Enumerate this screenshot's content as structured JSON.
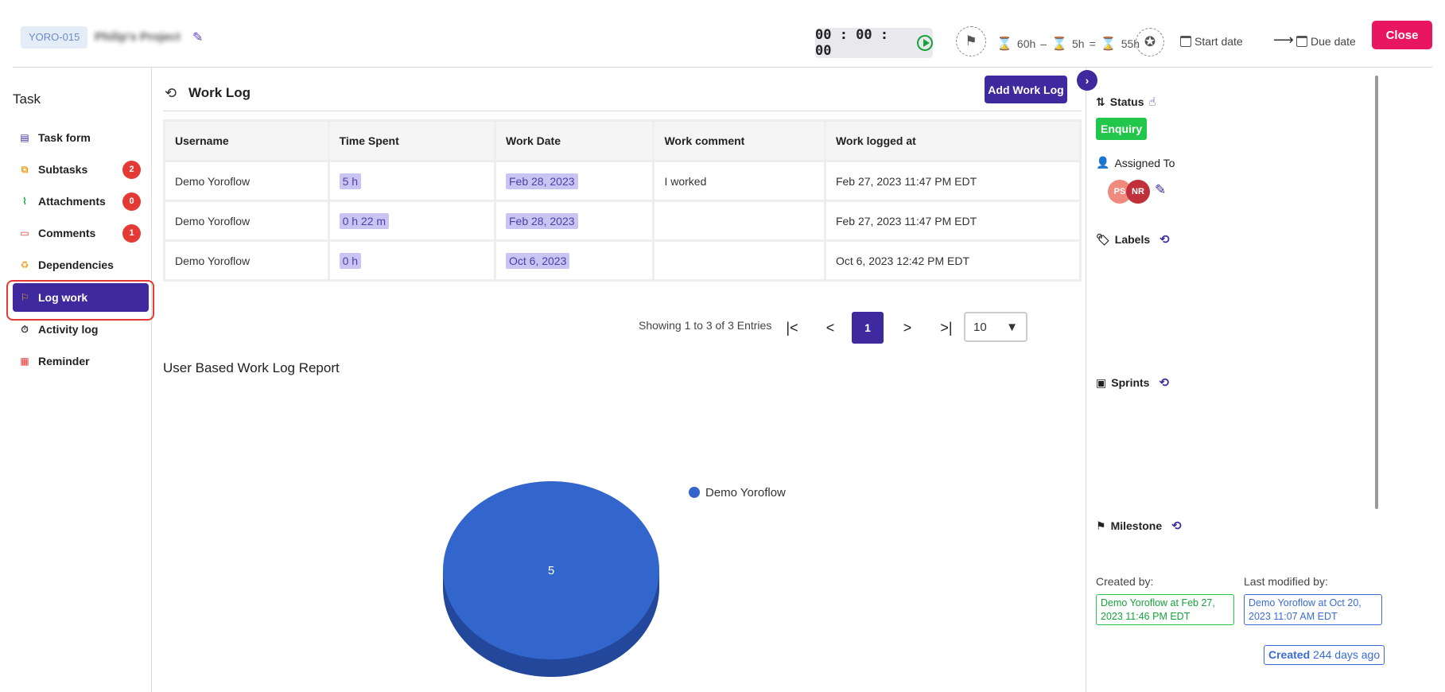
{
  "header": {
    "task_id": "YORO-015",
    "project_name": "Philip's Project",
    "timer": "00 : 00 : 00",
    "estimate": "60h",
    "minus": "–",
    "logged": "5h",
    "equals": "=",
    "remaining": "55h",
    "start_date": "Start date",
    "arrow": "⟶",
    "due_date": "Due date",
    "close_label": "Close"
  },
  "sidebar": {
    "title": "Task",
    "items": [
      {
        "label": "Task form",
        "icon": "form-icon",
        "color": "#3e2a9e"
      },
      {
        "label": "Subtasks",
        "icon": "subtasks-icon",
        "badge": "2",
        "color": "#f0a020"
      },
      {
        "label": "Attachments",
        "icon": "paperclip-icon",
        "badge": "0",
        "color": "#18a23c"
      },
      {
        "label": "Comments",
        "icon": "comment-icon",
        "badge": "1",
        "color": "#e53935"
      },
      {
        "label": "Dependencies",
        "icon": "recycle-icon",
        "color": "#f0a020"
      },
      {
        "label": "Log work",
        "icon": "flag-icon",
        "color": "#f0a020",
        "active": true
      },
      {
        "label": "Activity log",
        "icon": "stopwatch-icon",
        "color": "#333"
      },
      {
        "label": "Reminder",
        "icon": "calendar-icon",
        "color": "#e53935"
      }
    ]
  },
  "worklog": {
    "title": "Work Log",
    "add_label": "Add Work Log",
    "columns": [
      "Username",
      "Time Spent",
      "Work Date",
      "Work comment",
      "Work logged at"
    ],
    "rows": [
      [
        "Demo Yoroflow",
        "5 h",
        "Feb 28, 2023",
        "I worked",
        "Feb 27, 2023 11:47 PM EDT"
      ],
      [
        "Demo Yoroflow",
        "0 h 22 m",
        "Feb 28, 2023",
        "",
        "Feb 27, 2023 11:47 PM EDT"
      ],
      [
        "Demo Yoroflow",
        "0 h",
        "Oct 6, 2023",
        "",
        "Oct 6, 2023 12:42 PM EDT"
      ]
    ],
    "showing": "Showing 1 to 3 of 3 Entries",
    "page_first": "|<",
    "page_prev": "<",
    "page_current": "1",
    "page_next": ">",
    "page_last": ">|",
    "page_size": "10"
  },
  "report": {
    "title": "User Based Work Log Report"
  },
  "chart_data": {
    "type": "pie",
    "categories": [
      "Demo Yoroflow"
    ],
    "values": [
      5
    ],
    "legend_position": "top-right",
    "colors": [
      "#3366cc"
    ]
  },
  "right_panel": {
    "status_label": "Status",
    "status_value": "Enquiry",
    "assigned_label": "Assigned To",
    "assignees": [
      {
        "initials": "PS",
        "color": "#f08a7e"
      },
      {
        "initials": "NR",
        "color": "#c0303a"
      }
    ],
    "labels_label": "Labels",
    "sprints_label": "Sprints",
    "milestone_label": "Milestone",
    "created_by_label": "Created by:",
    "created_by_value": "Demo Yoroflow at Feb 27, 2023 11:46 PM EDT",
    "modified_by_label": "Last modified by:",
    "modified_by_value": "Demo Yoroflow at Oct 20, 2023 11:07 AM EDT",
    "created_prefix": "Created",
    "created_ago": "244 days ago"
  }
}
